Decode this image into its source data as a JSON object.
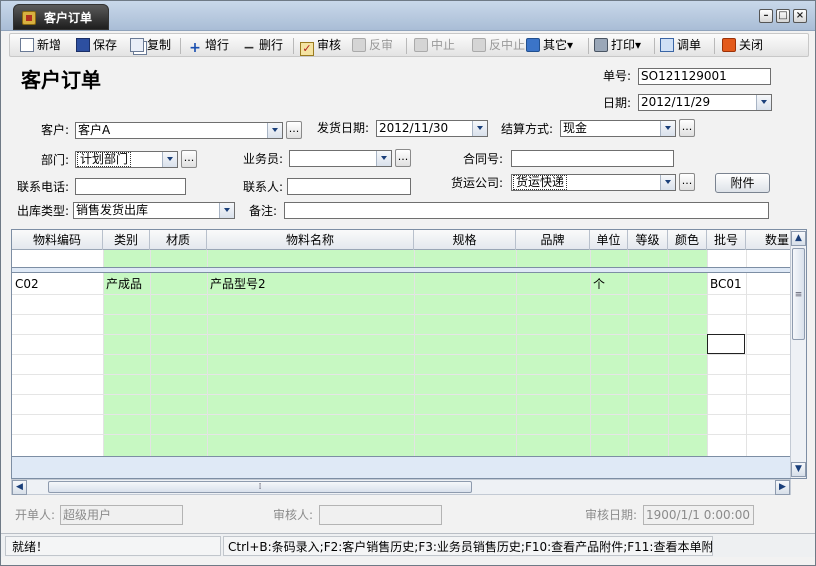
{
  "window": {
    "title": "客户订单",
    "controls": [
      "minimize-icon",
      "restore-icon",
      "close-icon"
    ]
  },
  "toolbar": {
    "new": "新增",
    "save": "保存",
    "copy": "复制",
    "add_row": "增行",
    "delete_row": "删行",
    "approve": "审核",
    "unapprove": "反审",
    "suspend": "中止",
    "unsuspend": "反中止",
    "other": "其它",
    "print": "打印",
    "adjust": "调单",
    "close": "关闭"
  },
  "form": {
    "title": "客户订单",
    "order_no": {
      "label": "单号:",
      "value": "SO121129001"
    },
    "date": {
      "label": "日期:",
      "value": "2012/11/29"
    },
    "customer": {
      "label": "客户:",
      "value": "客户A"
    },
    "ship_date": {
      "label": "发货日期:",
      "value": "2012/11/30"
    },
    "settlement": {
      "label": "结算方式:",
      "value": "现金"
    },
    "department": {
      "label": "部门:",
      "value": "计划部门"
    },
    "salesman": {
      "label": "业务员:",
      "value": ""
    },
    "contract_no": {
      "label": "合同号:",
      "value": ""
    },
    "phone": {
      "label": "联系电话:",
      "value": ""
    },
    "contact": {
      "label": "联系人:",
      "value": ""
    },
    "carrier": {
      "label": "货运公司:",
      "value": "货运快递"
    },
    "attachment_button": "附件",
    "outbound_type": {
      "label": "出库类型:",
      "value": "销售发货出库"
    },
    "remark": {
      "label": "备注:",
      "value": ""
    },
    "ellipsis": "..."
  },
  "grid": {
    "columns": [
      "物料编码",
      "类别",
      "材质",
      "物料名称",
      "规格",
      "品牌",
      "单位",
      "等级",
      "颜色",
      "批号",
      "数量"
    ],
    "rows": [
      {
        "code": "C02",
        "category": "产成品",
        "material": "",
        "name": "产品型号2",
        "spec": "",
        "brand": "",
        "unit": "个",
        "grade": "",
        "color": "",
        "batch": "BC01",
        "qty": ""
      }
    ],
    "green_color": "#c7f8c2"
  },
  "bottom": {
    "creator": {
      "label": "开单人:",
      "value": "超级用户"
    },
    "approver": {
      "label": "审核人:",
      "value": ""
    },
    "approve_date": {
      "label": "审核日期:",
      "value": "1900/1/1 0:00:00"
    }
  },
  "status": {
    "left": "就绪！",
    "right": "Ctrl+B:条码录入;F2:客户销售历史;F3:业务员销售历史;F10:查看产品附件;F11:查看本单附件"
  }
}
